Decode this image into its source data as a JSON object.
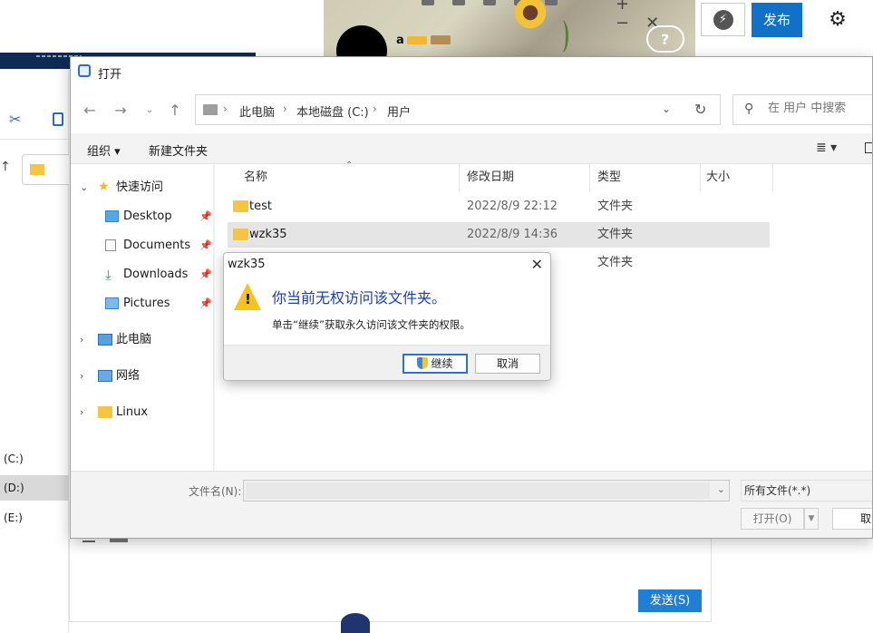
{
  "background": {
    "media_user": "a",
    "drives": [
      "(C:)",
      "(D:)",
      "(E:)"
    ],
    "publish_label": "发布",
    "send_label": "发送(S)"
  },
  "dialog": {
    "title": "打开",
    "breadcrumb": [
      "此电脑",
      "本地磁盘 (C:)",
      "用户"
    ],
    "search_placeholder": "在 用户 中搜索",
    "commands": {
      "organize": "组织 ▾",
      "new_folder": "新建文件夹"
    },
    "nav": {
      "quick_access": "快速访问",
      "pinned": [
        "Desktop",
        "Documents",
        "Downloads",
        "Pictures"
      ],
      "this_pc": "此电脑",
      "network": "网络",
      "linux": "Linux"
    },
    "columns": {
      "name": "名称",
      "modified": "修改日期",
      "type": "类型",
      "size": "大小"
    },
    "files": [
      {
        "name": "test",
        "date": "2022/8/9 22:12",
        "type": "文件夹"
      },
      {
        "name": "wzk35",
        "date": "2022/8/9 14:36",
        "type": "文件夹"
      },
      {
        "name": "",
        "date": "",
        "type": "文件夹"
      }
    ],
    "filename_label": "文件名(N):",
    "filename_value": "",
    "filter": "所有文件(*.*)",
    "open_label": "打开(O)",
    "cancel_label": "取消"
  },
  "alert": {
    "title": "wzk35",
    "message": "你当前无权访问该文件夹。",
    "detail": "单击“继续”获取永久访问该文件夹的权限。",
    "continue_label": "继续",
    "cancel_label": "取消"
  }
}
